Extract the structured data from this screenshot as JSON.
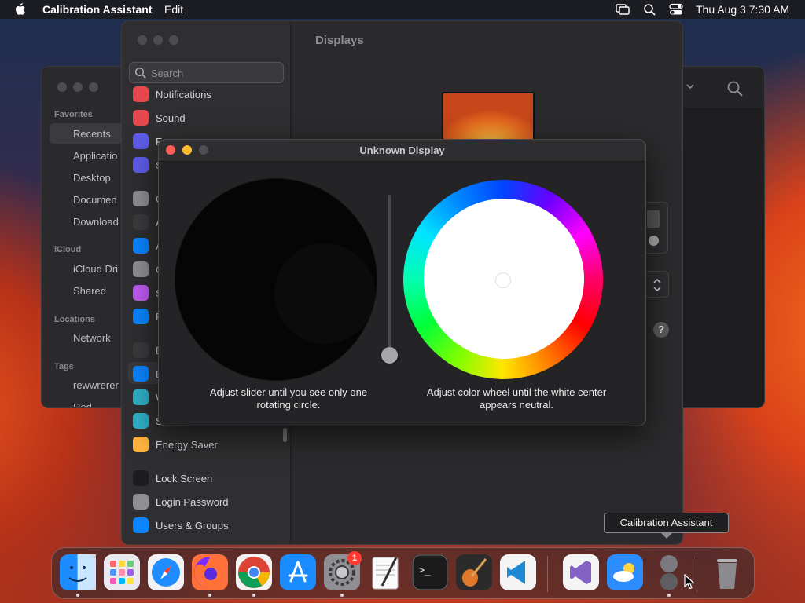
{
  "menubar": {
    "app_name": "Calibration Assistant",
    "menu_edit": "Edit",
    "clock": "Thu Aug 3  7:30 AM"
  },
  "finder": {
    "sections": {
      "favorites": "Favorites",
      "icloud": "iCloud",
      "locations": "Locations",
      "tags": "Tags"
    },
    "items": {
      "recents": "Recents",
      "applications": "Applicatio",
      "desktop": "Desktop",
      "documents": "Documen",
      "downloads": "Download",
      "icloud_drive": "iCloud Dri",
      "shared": "Shared",
      "network": "Network",
      "tag1": "rewwrerer",
      "tag2": "Red"
    }
  },
  "settings": {
    "search_placeholder": "Search",
    "section_title": "Displays",
    "items": [
      {
        "label": "Notifications",
        "color": "#e5484d"
      },
      {
        "label": "Sound",
        "color": "#e5484d"
      },
      {
        "label": "F",
        "color": "#5e5ce6"
      },
      {
        "label": "S",
        "color": "#5e5ce6"
      },
      {
        "label": "G",
        "color": "#8e8e93"
      },
      {
        "label": "A",
        "color": "#3a3a3c"
      },
      {
        "label": "A",
        "color": "#0a84ff"
      },
      {
        "label": "C",
        "color": "#8e8e93"
      },
      {
        "label": "S",
        "color": "#bf5af2"
      },
      {
        "label": "P",
        "color": "#0a84ff"
      },
      {
        "label": "D",
        "color": "#3a3a3c"
      },
      {
        "label": "D",
        "color": "#0a84ff"
      },
      {
        "label": "W",
        "color": "#30b0c7"
      },
      {
        "label": "S",
        "color": "#30b0c7"
      },
      {
        "label": "Energy Saver",
        "color": "#ffb340"
      },
      {
        "label": "Lock Screen",
        "color": "#1c1c1e"
      },
      {
        "label": "Login Password",
        "color": "#8e8e93"
      },
      {
        "label": "Users & Groups",
        "color": "#0a84ff"
      }
    ],
    "help_label": "?"
  },
  "dialog": {
    "title": "Unknown Display",
    "left_caption_line1": "Adjust slider until you see only one",
    "left_caption_line2": "rotating circle.",
    "right_caption_line1": "Adjust color wheel until the white center",
    "right_caption_line2": "appears neutral.",
    "slider_value": 0.0
  },
  "dock": {
    "tooltip": "Calibration Assistant",
    "settings_badge": "1",
    "apps": [
      {
        "name": "finder-icon",
        "color": "#1e8cff"
      },
      {
        "name": "launchpad-icon",
        "color": "#e9e9ee"
      },
      {
        "name": "safari-icon",
        "color": "#f2f2f4"
      },
      {
        "name": "firefox-icon",
        "color": "#ff7139"
      },
      {
        "name": "chrome-icon",
        "color": "#f2f2f2"
      },
      {
        "name": "app-store-icon",
        "color": "#1a8cff"
      },
      {
        "name": "system-settings-icon",
        "color": "#8e8e93"
      },
      {
        "name": "textedit-icon",
        "color": "#f5f5f5"
      },
      {
        "name": "terminal-icon",
        "color": "#1b1b1b"
      },
      {
        "name": "garageband-icon",
        "color": "#2b2b2b"
      },
      {
        "name": "vscode-icon",
        "color": "#f4f4f4"
      },
      {
        "name": "visual-studio-icon",
        "color": "#f4f4f4"
      },
      {
        "name": "weather-icon",
        "color": "#2a8cff"
      },
      {
        "name": "calibration-assistant-icon",
        "color": "#1a1a1a"
      },
      {
        "name": "trash-icon",
        "color": "#8a8a8e"
      }
    ]
  }
}
